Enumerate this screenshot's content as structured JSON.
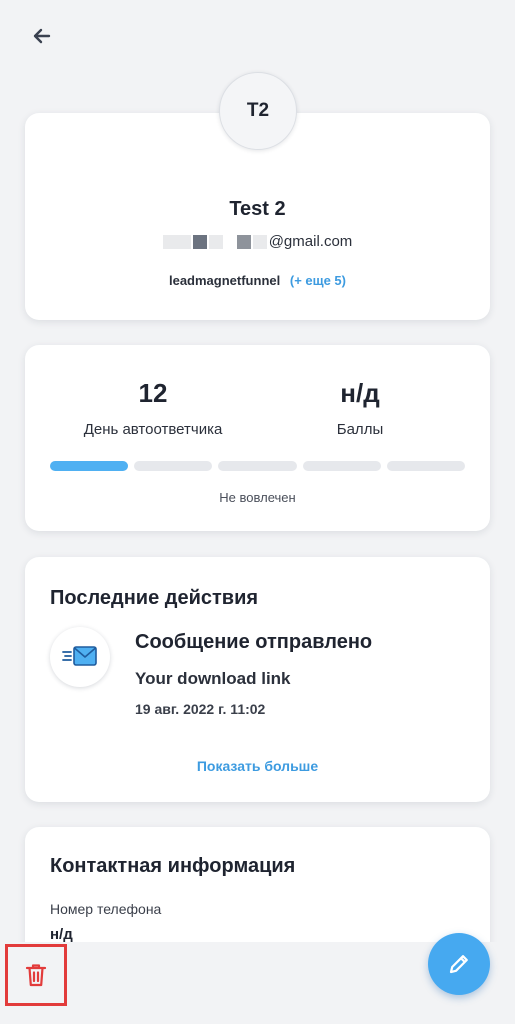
{
  "header": {
    "back_icon": "arrow-left-icon"
  },
  "profile": {
    "initials": "T2",
    "name": "Test 2",
    "email_visible": "@gmail.com",
    "primary_tag": "leadmagnetfunnel",
    "more_tags": "(+ еще 5)"
  },
  "stats": {
    "autoresponder_day_value": "12",
    "autoresponder_day_label": "День автоответчика",
    "points_value": "н/д",
    "points_label": "Баллы",
    "engagement_level": 0.2,
    "engagement_label": "Не вовлечен"
  },
  "activity": {
    "title": "Последние действия",
    "item": {
      "icon": "email-sent-icon",
      "title": "Сообщение отправлено",
      "subject": "Your download link",
      "date": "19 авг. 2022 г. 11:02"
    },
    "show_more": "Показать больше"
  },
  "contact": {
    "title": "Контактная информация",
    "phone_label": "Номер телефона",
    "phone_value": "н/д"
  },
  "actions": {
    "delete_icon": "trash-icon",
    "edit_icon": "pencil-icon"
  },
  "colors": {
    "accent": "#3d9be0",
    "progress_fill": "#4fb0f2",
    "delete_highlight": "#e23b3b",
    "fab": "#46a9f0"
  }
}
